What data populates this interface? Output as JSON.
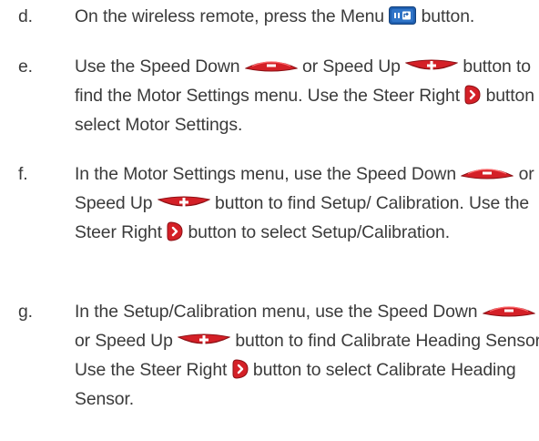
{
  "steps": [
    {
      "marker": "d.",
      "parts": [
        "On the wireless remote, press the Menu ",
        " button."
      ]
    },
    {
      "marker": "e.",
      "parts": [
        "Use the Speed Down ",
        " or Speed Up ",
        " button to find the Motor Settings menu. Use the Steer Right ",
        " button to select Motor Settings."
      ]
    },
    {
      "marker": "f.",
      "parts": [
        "In the Motor Settings menu, use the Speed Down ",
        " or Speed Up ",
        " button to find Setup/ Calibration. Use the Steer Right ",
        " button to select Setup/Calibration."
      ]
    },
    {
      "marker": "g.",
      "parts": [
        "In the Setup/Calibration menu, use the Speed Down ",
        " or Speed Up ",
        " button to find Calibrate Heading Sensor. Use the Steer Right ",
        " button to select Calibrate Heading Sensor."
      ]
    }
  ],
  "icons": {
    "menu": "menu-button-icon",
    "speed_down": "speed-down-button-icon",
    "speed_up": "speed-up-button-icon",
    "steer_right": "steer-right-button-icon"
  },
  "colors": {
    "text": "#3b3b3b",
    "button_red": "#d42027",
    "menu_blue": "#1f5fb0"
  }
}
